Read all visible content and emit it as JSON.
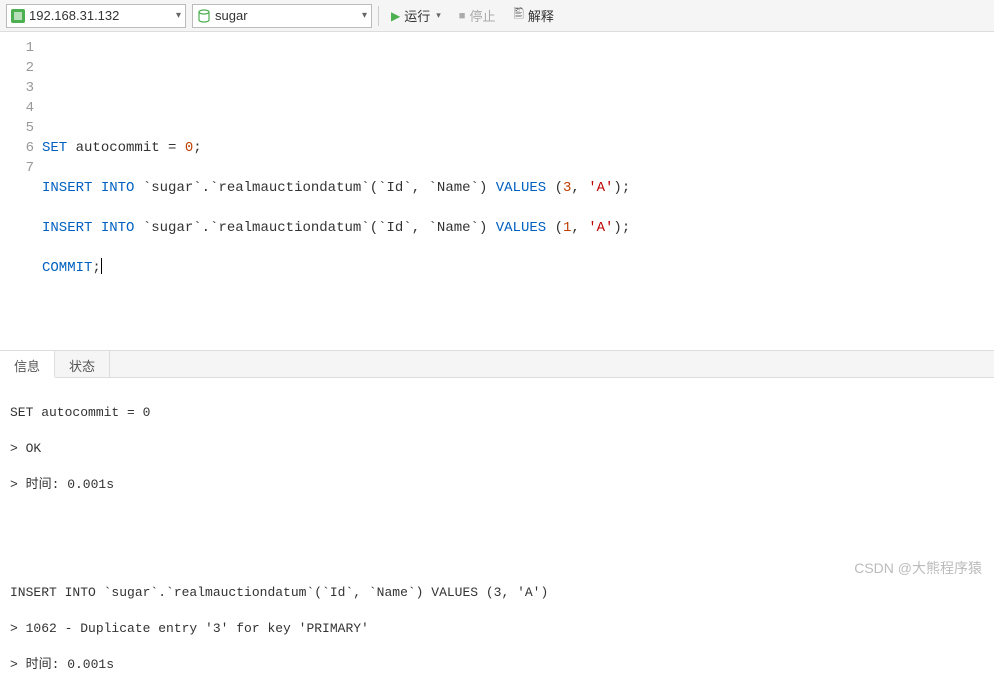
{
  "toolbar": {
    "connection": "192.168.31.132",
    "database": "sugar",
    "run_label": "运行",
    "stop_label": "停止",
    "explain_label": "解释"
  },
  "editor": {
    "lines": [
      "",
      "",
      "SET autocommit = 0;",
      "INSERT INTO `sugar`.`realmauctiondatum`(`Id`, `Name`) VALUES (3, 'A');",
      "INSERT INTO `sugar`.`realmauctiondatum`(`Id`, `Name`) VALUES (1, 'A');",
      "COMMIT;",
      ""
    ],
    "line_numbers": [
      "1",
      "2",
      "3",
      "4",
      "5",
      "6",
      "7"
    ]
  },
  "tabs": {
    "info_label": "信息",
    "status_label": "状态"
  },
  "output": {
    "block1_line1": "SET autocommit = 0",
    "block1_line2": "> OK",
    "block1_line3": "> 时间: 0.001s",
    "block2_line1": "INSERT INTO `sugar`.`realmauctiondatum`(`Id`, `Name`) VALUES (3, 'A')",
    "block2_line2": "> 1062 - Duplicate entry '3' for key 'PRIMARY'",
    "block2_line3": "> 时间: 0.001s"
  },
  "watermark": "CSDN @大熊程序猿"
}
